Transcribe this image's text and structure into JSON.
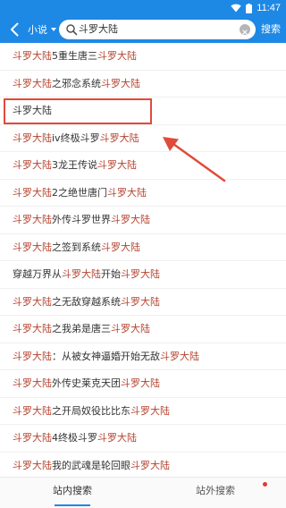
{
  "status_bar": {
    "time": "11:47"
  },
  "top_bar": {
    "back_icon": "back-arrow-icon",
    "category": "小说",
    "search_value": "斗罗大陆",
    "search_button": "搜索"
  },
  "results": [
    {
      "before": "",
      "highlight": "斗罗大陆",
      "after": "5重生唐三",
      "tail": "斗罗大陆"
    },
    {
      "before": "",
      "highlight": "斗罗大陆",
      "after": "之邪念系统",
      "tail": "斗罗大陆"
    },
    {
      "before": "",
      "highlight": "",
      "after": "斗罗大陆",
      "tail": ""
    },
    {
      "before": "",
      "highlight": "斗罗大陆",
      "after": "iv终极斗罗",
      "tail": "斗罗大陆"
    },
    {
      "before": "",
      "highlight": "斗罗大陆",
      "after": "3龙王传说",
      "tail": "斗罗大陆"
    },
    {
      "before": "",
      "highlight": "斗罗大陆",
      "after": "2之绝世唐门",
      "tail": "斗罗大陆"
    },
    {
      "before": "",
      "highlight": "斗罗大陆",
      "after": "外传斗罗世界",
      "tail": "斗罗大陆"
    },
    {
      "before": "",
      "highlight": "斗罗大陆",
      "after": "之签到系统",
      "tail": "斗罗大陆"
    },
    {
      "before": "穿越万界从",
      "highlight": "斗罗大陆",
      "after": "开始",
      "tail": "斗罗大陆"
    },
    {
      "before": "",
      "highlight": "斗罗大陆",
      "after": "之无敌穿越系统",
      "tail": "斗罗大陆"
    },
    {
      "before": "",
      "highlight": "斗罗大陆",
      "after": "之我弟是唐三",
      "tail": "斗罗大陆"
    },
    {
      "before": "",
      "highlight": "斗罗大陆",
      "after": "：从被女神逼婚开始无敌",
      "tail": "斗罗大陆"
    },
    {
      "before": "",
      "highlight": "斗罗大陆",
      "after": "外传史莱克天团",
      "tail": "斗罗大陆"
    },
    {
      "before": "",
      "highlight": "斗罗大陆",
      "after": "之开局奴役比比东",
      "tail": "斗罗大陆"
    },
    {
      "before": "",
      "highlight": "斗罗大陆",
      "after": "4终极斗罗",
      "tail": "斗罗大陆"
    },
    {
      "before": "",
      "highlight": "斗罗大陆",
      "after": "我的武魂是轮回眼",
      "tail": "斗罗大陆"
    }
  ],
  "bottom_tabs": {
    "in_site": "站内搜索",
    "out_site": "站外搜索"
  },
  "colors": {
    "primary": "#1e88e5",
    "highlight_text": "#b5432f",
    "annotation": "#e04b3a"
  }
}
